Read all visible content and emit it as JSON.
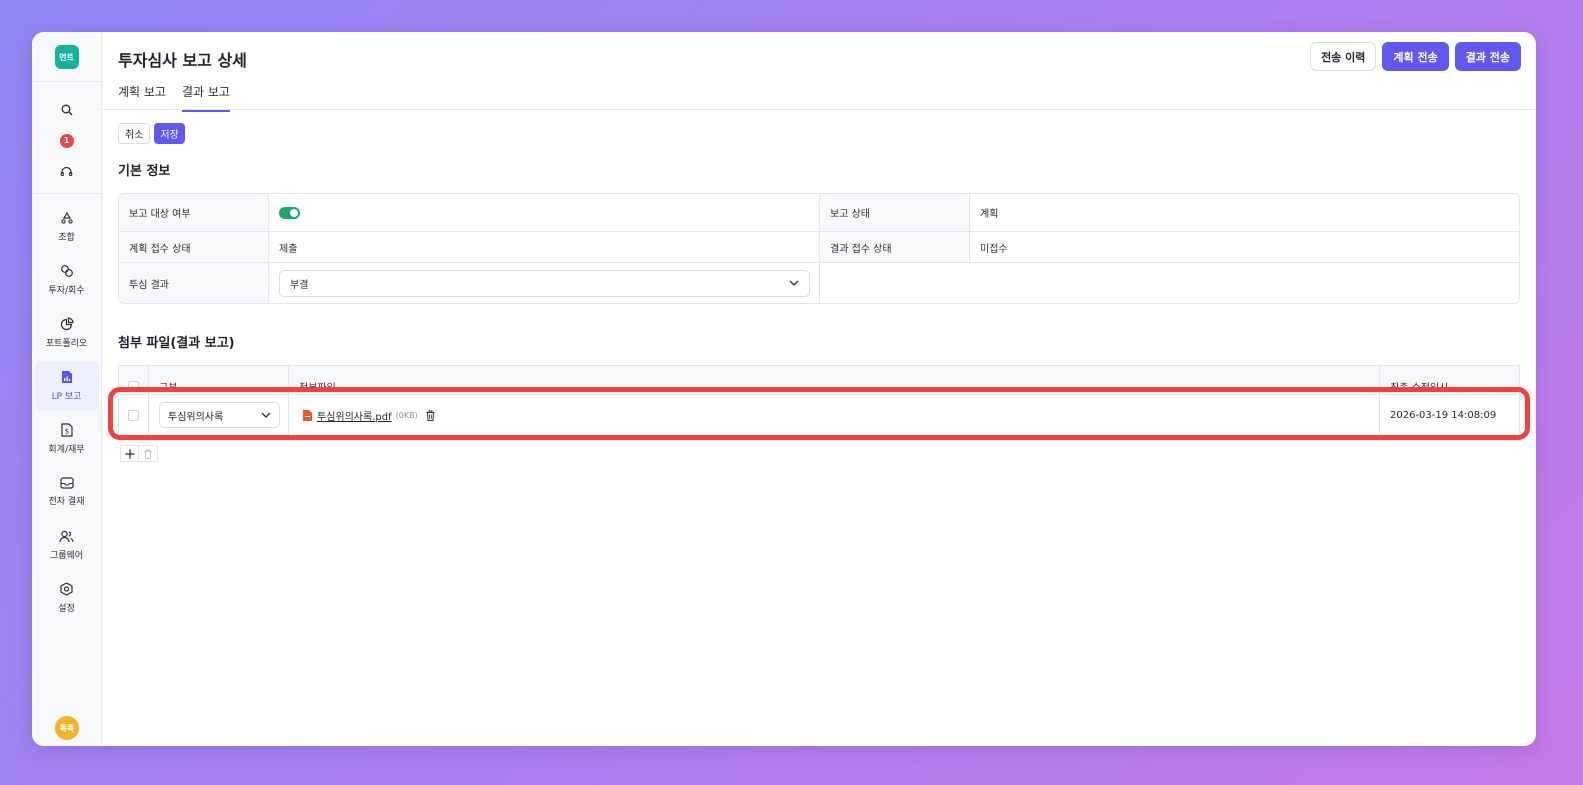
{
  "sidebar": {
    "logo": "먼트",
    "top_icons": [
      "search-icon",
      "notification-badge",
      "headset-icon"
    ],
    "notification_count": "1",
    "items": [
      {
        "label": "조합",
        "icon": "recycle-icon",
        "active": false
      },
      {
        "label": "투자/회수",
        "icon": "link-icon",
        "active": false
      },
      {
        "label": "포트폴리오",
        "icon": "pie-chart-icon",
        "active": false
      },
      {
        "label": "LP 보고",
        "icon": "report-icon",
        "active": true
      },
      {
        "label": "회계/재무",
        "icon": "dollar-file-icon",
        "active": false
      },
      {
        "label": "전자 결재",
        "icon": "inbox-icon",
        "active": false
      },
      {
        "label": "그룹웨어",
        "icon": "users-icon",
        "active": false
      },
      {
        "label": "설정",
        "icon": "gear-icon",
        "active": false
      }
    ],
    "avatar": "똑똑"
  },
  "header": {
    "title": "투자심사 보고 상세",
    "buttons": {
      "history": "전송 이력",
      "plan_send": "계획 전송",
      "result_send": "결과 전송"
    },
    "tabs": [
      {
        "label": "계획 보고",
        "active": false
      },
      {
        "label": "결과 보고",
        "active": true
      }
    ]
  },
  "actions": {
    "cancel": "취소",
    "save": "저장"
  },
  "basic_info": {
    "title": "기본 정보",
    "report_target_label": "보고 대상 여부",
    "report_target_on": true,
    "report_status_label": "보고 상태",
    "report_status_value": "계획",
    "plan_receipt_label": "계획 접수 상태",
    "plan_receipt_value": "제출",
    "result_receipt_label": "결과 접수 상태",
    "result_receipt_value": "미접수",
    "review_result_label": "투심 결과",
    "review_result_value": "부결"
  },
  "attachments": {
    "title": "첨부 파일(결과 보고)",
    "columns": {
      "type": "구분",
      "file": "첨부파일",
      "modified": "최종 수정일시"
    },
    "rows": [
      {
        "type": "투심위의사록",
        "file_name": "투심위의사록.pdf",
        "file_size": "(0KB)",
        "modified": "2026-03-19 14:08:09"
      }
    ]
  },
  "colors": {
    "accent": "#6058ef",
    "toggle_on": "#22a56b",
    "highlight": "#f0413a",
    "logo": "#14b39a"
  }
}
